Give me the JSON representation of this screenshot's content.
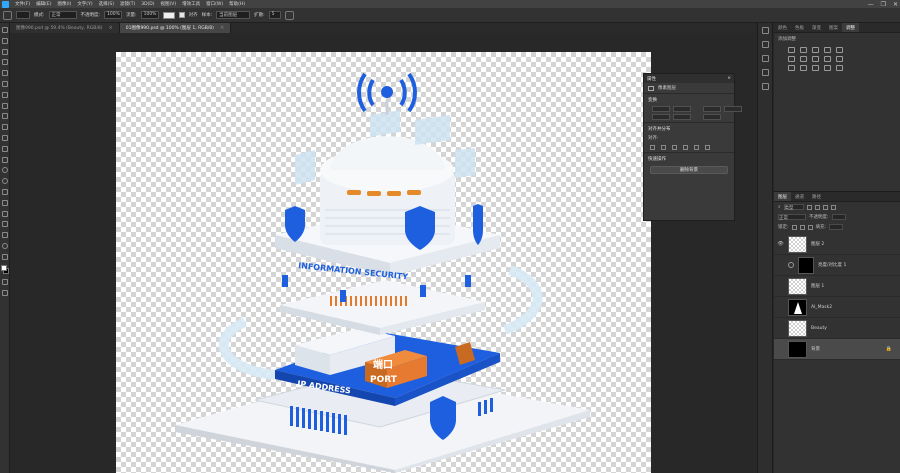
{
  "menubar": {
    "items": [
      "文件(F)",
      "编辑(E)",
      "图像(I)",
      "文字(Y)",
      "选择(S)",
      "滤镜(T)",
      "3D(D)",
      "视图(V)",
      "增效工具",
      "窗口(W)",
      "帮助(H)"
    ],
    "window_controls": [
      "—",
      "❐",
      "✕"
    ]
  },
  "optionsbar": {
    "mode_label": "模式:",
    "mode_value": "正常",
    "opacity_label": "不透明度:",
    "opacity_value": "100%",
    "flow_label": "流量:",
    "flow_value": "100%",
    "align_label": "对齐",
    "sample_label": "样本:",
    "sample_value": "当前图层",
    "diffusion_label": "扩散:",
    "diffusion_value": "5"
  },
  "tabs": [
    {
      "label": "图像990.psd @ 59.4% (Beauty, RGB/8)",
      "active": false
    },
    {
      "label": "01图像990.psd @ 100% (图层 1, RGB/8)",
      "active": true
    }
  ],
  "artwork": {
    "band_label": "INFORMATION SECURITY",
    "base_label": "IP ADDRESS",
    "port_cn": "端口",
    "port_en": "PORT"
  },
  "properties": {
    "title": "属性",
    "layer_kind": "像素图层",
    "transform_label": "变换",
    "align_label": "对齐并分布",
    "align_sub": "对齐:",
    "quick_label": "快速操作",
    "remove_bg_label": "删除背景",
    "close": "×"
  },
  "right_panel": {
    "top_tabs": [
      "颜色",
      "色板",
      "渐变",
      "图案",
      "调整"
    ],
    "active_top_tab": 4,
    "adjust_label": "添加调整",
    "layer_tabs": [
      "图层",
      "通道",
      "路径"
    ],
    "kind_label": "类型",
    "blend_value": "正常",
    "opacity_label": "不透明度:",
    "lock_label": "锁定:",
    "fill_label": "填充:"
  },
  "layers": [
    {
      "name": "图层 2",
      "thumb": "checker",
      "visible": true,
      "selected": false
    },
    {
      "name": "亮度/对比度 1",
      "thumb": "mask",
      "visible": false,
      "selected": false
    },
    {
      "name": "图层 1",
      "thumb": "checker",
      "visible": false,
      "selected": false
    },
    {
      "name": "AI_Mask2",
      "thumb": "tree",
      "visible": false,
      "selected": false
    },
    {
      "name": "Beauty",
      "thumb": "checker",
      "visible": false,
      "selected": false
    },
    {
      "name": "背景",
      "thumb": "black",
      "visible": false,
      "selected": true
    }
  ],
  "colors": {
    "accent_blue": "#1e5fe0",
    "accent_orange": "#e58a2a",
    "ps_blue": "#31a8ff"
  }
}
